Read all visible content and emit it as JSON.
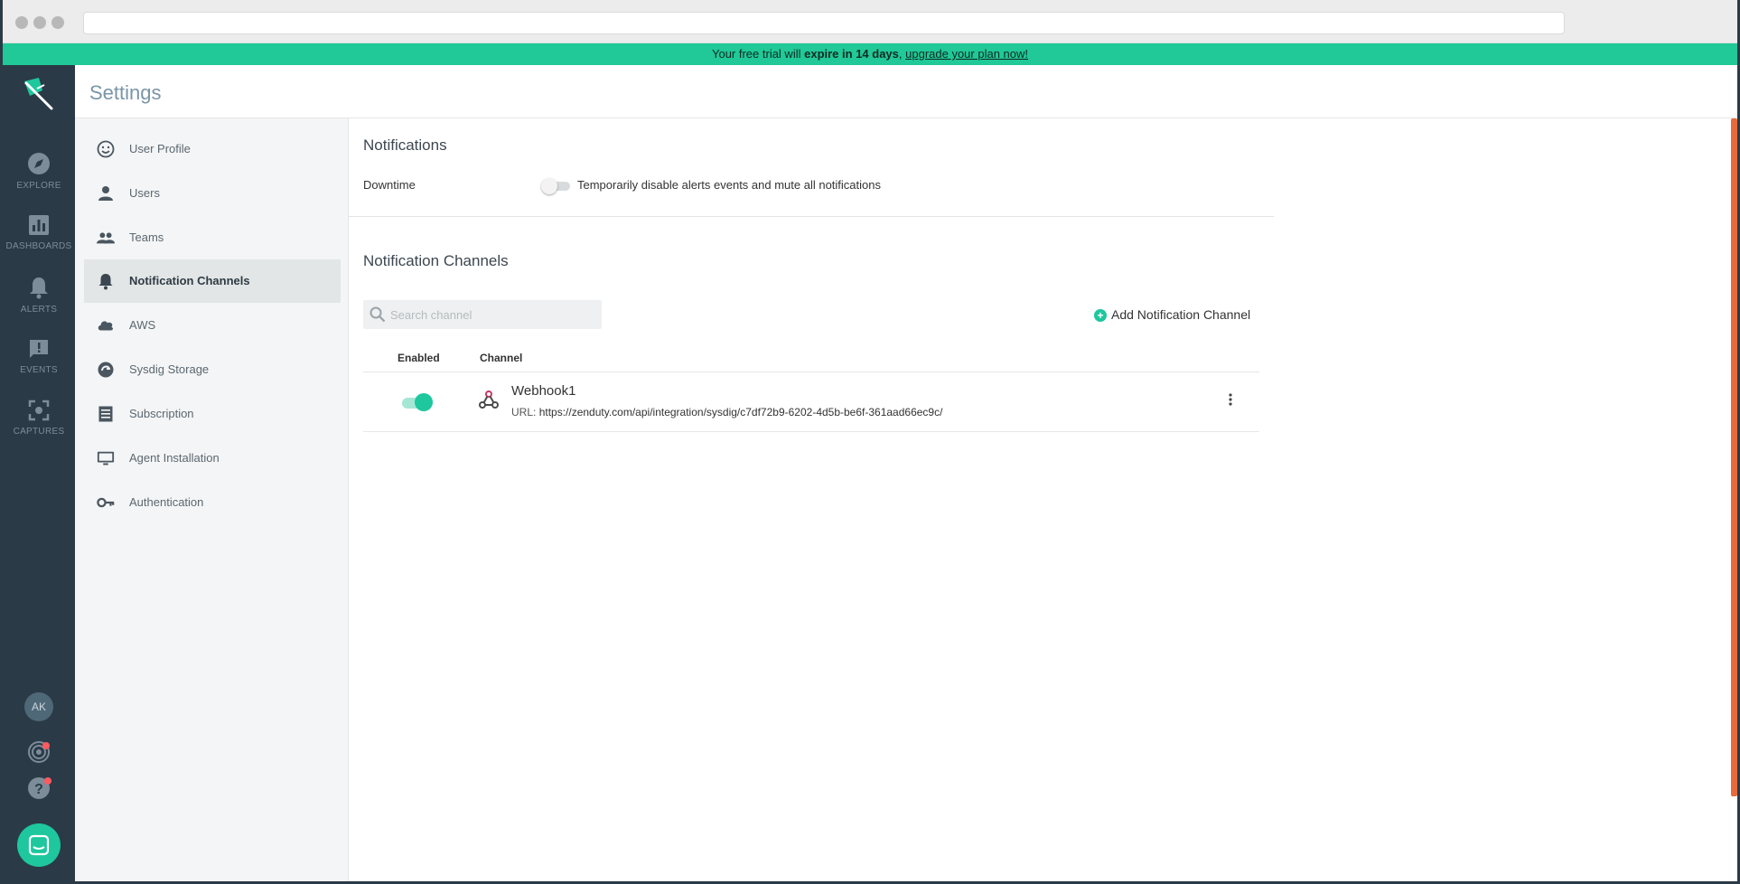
{
  "banner": {
    "prefix": "Your free trial will ",
    "bold": "expire in 14 days",
    "comma": ", ",
    "link": "upgrade your plan now!"
  },
  "nav": {
    "items": [
      {
        "label": "EXPLORE",
        "icon": "compass-icon"
      },
      {
        "label": "DASHBOARDS",
        "icon": "dashboard-icon"
      },
      {
        "label": "ALERTS",
        "icon": "bell-icon"
      },
      {
        "label": "EVENTS",
        "icon": "events-icon"
      },
      {
        "label": "CAPTURES",
        "icon": "capture-icon"
      }
    ],
    "avatar": "AK"
  },
  "header": {
    "title": "Settings"
  },
  "sidebar": {
    "items": [
      {
        "label": "User Profile",
        "icon": "smiley-icon"
      },
      {
        "label": "Users",
        "icon": "person-icon"
      },
      {
        "label": "Teams",
        "icon": "people-icon"
      },
      {
        "label": "Notification Channels",
        "icon": "bell-icon",
        "active": true
      },
      {
        "label": "AWS",
        "icon": "cloud-icon"
      },
      {
        "label": "Sysdig Storage",
        "icon": "storage-icon"
      },
      {
        "label": "Subscription",
        "icon": "receipt-icon"
      },
      {
        "label": "Agent Installation",
        "icon": "monitor-icon"
      },
      {
        "label": "Authentication",
        "icon": "key-icon"
      }
    ]
  },
  "notifications": {
    "title": "Notifications",
    "downtime_label": "Downtime",
    "downtime_desc": "Temporarily disable alerts events and mute all notifications",
    "downtime_enabled": false
  },
  "channels": {
    "title": "Notification Channels",
    "search_placeholder": "Search channel",
    "add_label": "Add Notification Channel",
    "col_enabled": "Enabled",
    "col_channel": "Channel",
    "rows": [
      {
        "name": "Webhook1",
        "url_label": "URL: ",
        "url": "https://zenduty.com/api/integration/sysdig/c7df72b9-6202-4d5b-be6f-361aad66ec9c/",
        "enabled": true,
        "icon": "webhook-icon"
      }
    ]
  },
  "colors": {
    "accent": "#1ec79d",
    "nav_bg": "#2b3a47",
    "banner": "#20c997"
  }
}
